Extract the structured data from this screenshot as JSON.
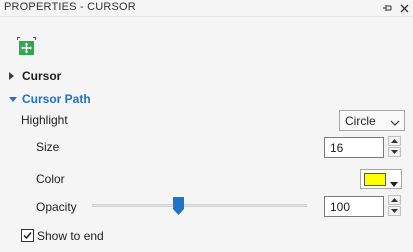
{
  "panel": {
    "title": "PROPERTIES - CURSOR"
  },
  "icons": {
    "title_actions": [
      "pin-icon",
      "close-icon"
    ],
    "toolbar": "cursor-move-icon",
    "accent": "#2fa84f"
  },
  "sections": {
    "cursor": {
      "label": "Cursor",
      "expanded": false
    },
    "cursor_path": {
      "label": "Cursor Path",
      "expanded": true
    }
  },
  "properties": {
    "highlight": {
      "label": "Highlight",
      "value": "Circle"
    },
    "size": {
      "label": "Size",
      "value": "16"
    },
    "color": {
      "label": "Color",
      "value": "#ffff00"
    },
    "opacity": {
      "label": "Opacity",
      "value": "100",
      "slider_fraction": 0.4
    },
    "show_to_end": {
      "label": "Show to end",
      "checked": true
    }
  },
  "colors": {
    "accent_blue": "#1e72c8",
    "background": "#f5f5f5"
  }
}
